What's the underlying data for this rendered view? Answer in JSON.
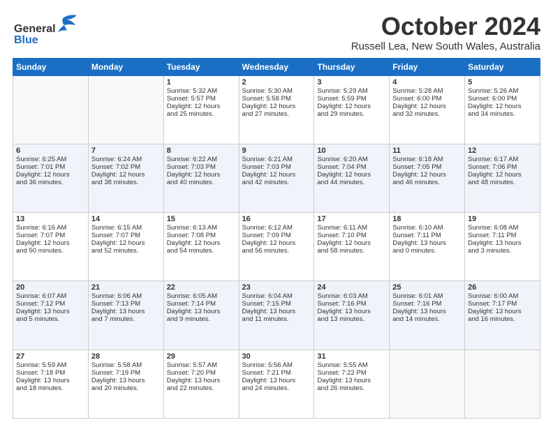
{
  "header": {
    "logo_general": "General",
    "logo_blue": "Blue",
    "month_title": "October 2024",
    "location": "Russell Lea, New South Wales, Australia"
  },
  "days_of_week": [
    "Sunday",
    "Monday",
    "Tuesday",
    "Wednesday",
    "Thursday",
    "Friday",
    "Saturday"
  ],
  "weeks": [
    [
      {
        "day": "",
        "sunrise": "",
        "sunset": "",
        "daylight": "",
        "minutes": "",
        "empty": true
      },
      {
        "day": "",
        "sunrise": "",
        "sunset": "",
        "daylight": "",
        "minutes": "",
        "empty": true
      },
      {
        "day": "1",
        "sunrise": "Sunrise: 5:32 AM",
        "sunset": "Sunset: 5:57 PM",
        "daylight": "Daylight: 12 hours",
        "minutes": "and 25 minutes."
      },
      {
        "day": "2",
        "sunrise": "Sunrise: 5:30 AM",
        "sunset": "Sunset: 5:58 PM",
        "daylight": "Daylight: 12 hours",
        "minutes": "and 27 minutes."
      },
      {
        "day": "3",
        "sunrise": "Sunrise: 5:29 AM",
        "sunset": "Sunset: 5:59 PM",
        "daylight": "Daylight: 12 hours",
        "minutes": "and 29 minutes."
      },
      {
        "day": "4",
        "sunrise": "Sunrise: 5:28 AM",
        "sunset": "Sunset: 6:00 PM",
        "daylight": "Daylight: 12 hours",
        "minutes": "and 32 minutes."
      },
      {
        "day": "5",
        "sunrise": "Sunrise: 5:26 AM",
        "sunset": "Sunset: 6:00 PM",
        "daylight": "Daylight: 12 hours",
        "minutes": "and 34 minutes."
      }
    ],
    [
      {
        "day": "6",
        "sunrise": "Sunrise: 6:25 AM",
        "sunset": "Sunset: 7:01 PM",
        "daylight": "Daylight: 12 hours",
        "minutes": "and 36 minutes."
      },
      {
        "day": "7",
        "sunrise": "Sunrise: 6:24 AM",
        "sunset": "Sunset: 7:02 PM",
        "daylight": "Daylight: 12 hours",
        "minutes": "and 38 minutes."
      },
      {
        "day": "8",
        "sunrise": "Sunrise: 6:22 AM",
        "sunset": "Sunset: 7:03 PM",
        "daylight": "Daylight: 12 hours",
        "minutes": "and 40 minutes."
      },
      {
        "day": "9",
        "sunrise": "Sunrise: 6:21 AM",
        "sunset": "Sunset: 7:03 PM",
        "daylight": "Daylight: 12 hours",
        "minutes": "and 42 minutes."
      },
      {
        "day": "10",
        "sunrise": "Sunrise: 6:20 AM",
        "sunset": "Sunset: 7:04 PM",
        "daylight": "Daylight: 12 hours",
        "minutes": "and 44 minutes."
      },
      {
        "day": "11",
        "sunrise": "Sunrise: 6:18 AM",
        "sunset": "Sunset: 7:05 PM",
        "daylight": "Daylight: 12 hours",
        "minutes": "and 46 minutes."
      },
      {
        "day": "12",
        "sunrise": "Sunrise: 6:17 AM",
        "sunset": "Sunset: 7:06 PM",
        "daylight": "Daylight: 12 hours",
        "minutes": "and 48 minutes."
      }
    ],
    [
      {
        "day": "13",
        "sunrise": "Sunrise: 6:16 AM",
        "sunset": "Sunset: 7:07 PM",
        "daylight": "Daylight: 12 hours",
        "minutes": "and 50 minutes."
      },
      {
        "day": "14",
        "sunrise": "Sunrise: 6:15 AM",
        "sunset": "Sunset: 7:07 PM",
        "daylight": "Daylight: 12 hours",
        "minutes": "and 52 minutes."
      },
      {
        "day": "15",
        "sunrise": "Sunrise: 6:13 AM",
        "sunset": "Sunset: 7:08 PM",
        "daylight": "Daylight: 12 hours",
        "minutes": "and 54 minutes."
      },
      {
        "day": "16",
        "sunrise": "Sunrise: 6:12 AM",
        "sunset": "Sunset: 7:09 PM",
        "daylight": "Daylight: 12 hours",
        "minutes": "and 56 minutes."
      },
      {
        "day": "17",
        "sunrise": "Sunrise: 6:11 AM",
        "sunset": "Sunset: 7:10 PM",
        "daylight": "Daylight: 12 hours",
        "minutes": "and 58 minutes."
      },
      {
        "day": "18",
        "sunrise": "Sunrise: 6:10 AM",
        "sunset": "Sunset: 7:11 PM",
        "daylight": "Daylight: 13 hours",
        "minutes": "and 0 minutes."
      },
      {
        "day": "19",
        "sunrise": "Sunrise: 6:08 AM",
        "sunset": "Sunset: 7:11 PM",
        "daylight": "Daylight: 13 hours",
        "minutes": "and 3 minutes."
      }
    ],
    [
      {
        "day": "20",
        "sunrise": "Sunrise: 6:07 AM",
        "sunset": "Sunset: 7:12 PM",
        "daylight": "Daylight: 13 hours",
        "minutes": "and 5 minutes."
      },
      {
        "day": "21",
        "sunrise": "Sunrise: 6:06 AM",
        "sunset": "Sunset: 7:13 PM",
        "daylight": "Daylight: 13 hours",
        "minutes": "and 7 minutes."
      },
      {
        "day": "22",
        "sunrise": "Sunrise: 6:05 AM",
        "sunset": "Sunset: 7:14 PM",
        "daylight": "Daylight: 13 hours",
        "minutes": "and 9 minutes."
      },
      {
        "day": "23",
        "sunrise": "Sunrise: 6:04 AM",
        "sunset": "Sunset: 7:15 PM",
        "daylight": "Daylight: 13 hours",
        "minutes": "and 11 minutes."
      },
      {
        "day": "24",
        "sunrise": "Sunrise: 6:03 AM",
        "sunset": "Sunset: 7:16 PM",
        "daylight": "Daylight: 13 hours",
        "minutes": "and 13 minutes."
      },
      {
        "day": "25",
        "sunrise": "Sunrise: 6:01 AM",
        "sunset": "Sunset: 7:16 PM",
        "daylight": "Daylight: 13 hours",
        "minutes": "and 14 minutes."
      },
      {
        "day": "26",
        "sunrise": "Sunrise: 6:00 AM",
        "sunset": "Sunset: 7:17 PM",
        "daylight": "Daylight: 13 hours",
        "minutes": "and 16 minutes."
      }
    ],
    [
      {
        "day": "27",
        "sunrise": "Sunrise: 5:59 AM",
        "sunset": "Sunset: 7:18 PM",
        "daylight": "Daylight: 13 hours",
        "minutes": "and 18 minutes."
      },
      {
        "day": "28",
        "sunrise": "Sunrise: 5:58 AM",
        "sunset": "Sunset: 7:19 PM",
        "daylight": "Daylight: 13 hours",
        "minutes": "and 20 minutes."
      },
      {
        "day": "29",
        "sunrise": "Sunrise: 5:57 AM",
        "sunset": "Sunset: 7:20 PM",
        "daylight": "Daylight: 13 hours",
        "minutes": "and 22 minutes."
      },
      {
        "day": "30",
        "sunrise": "Sunrise: 5:56 AM",
        "sunset": "Sunset: 7:21 PM",
        "daylight": "Daylight: 13 hours",
        "minutes": "and 24 minutes."
      },
      {
        "day": "31",
        "sunrise": "Sunrise: 5:55 AM",
        "sunset": "Sunset: 7:22 PM",
        "daylight": "Daylight: 13 hours",
        "minutes": "and 26 minutes."
      },
      {
        "day": "",
        "sunrise": "",
        "sunset": "",
        "daylight": "",
        "minutes": "",
        "empty": true
      },
      {
        "day": "",
        "sunrise": "",
        "sunset": "",
        "daylight": "",
        "minutes": "",
        "empty": true
      }
    ]
  ]
}
